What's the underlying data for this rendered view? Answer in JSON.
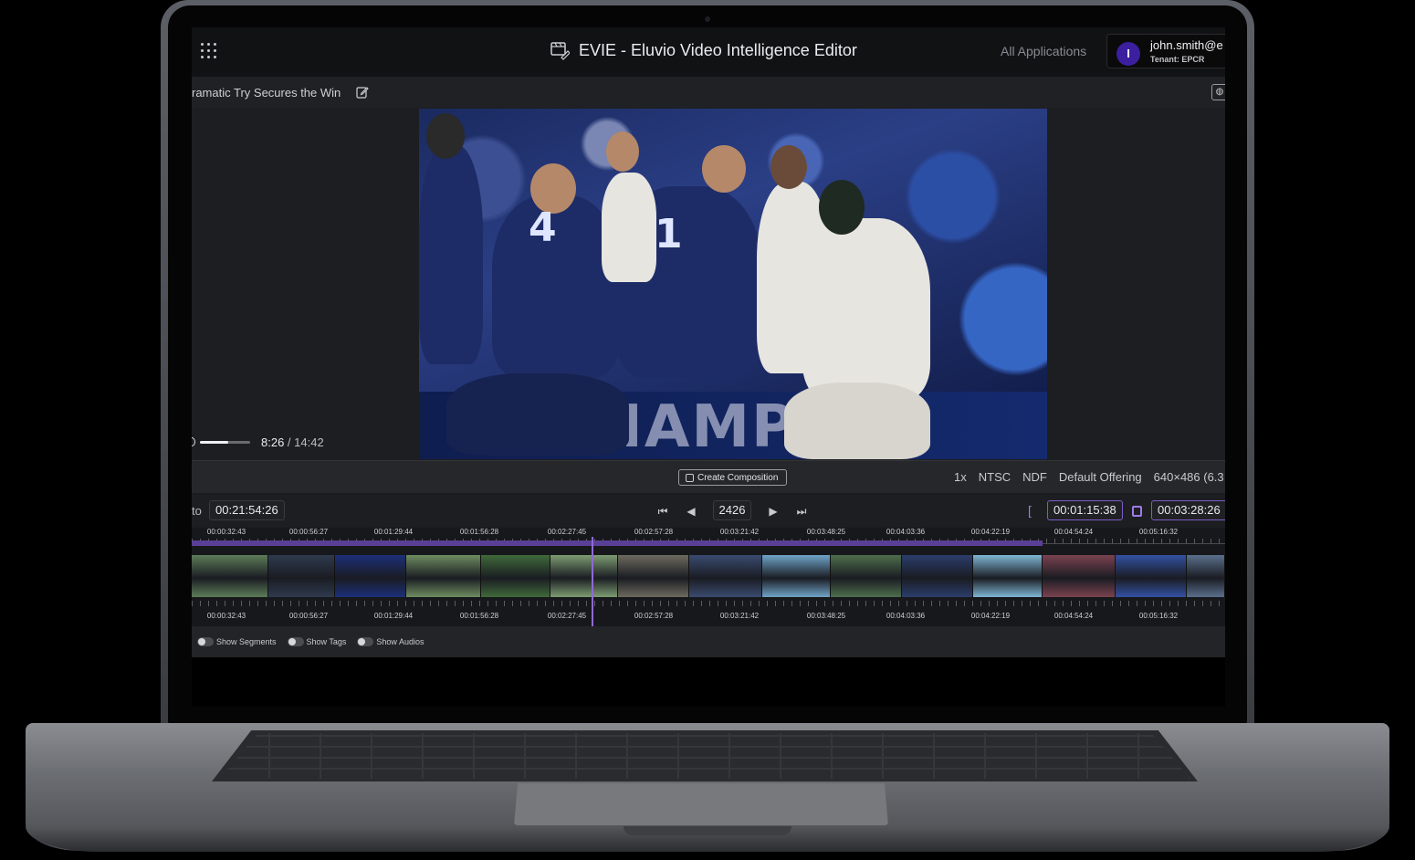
{
  "header": {
    "app_title": "EVIE - Eluvio Video Intelligence Editor",
    "all_apps_label": "All Applications",
    "user": {
      "avatar_initial": "I",
      "name": "john.smith@e",
      "tenant": "Tenant:  EPCR"
    }
  },
  "clip": {
    "title": "ramatic Try Secures the Win"
  },
  "video": {
    "banner_text": "te    CHAMPIC",
    "jersey_numbers": [
      "4",
      "1"
    ],
    "current_time": "8:26",
    "separator": " / ",
    "duration": "14:42",
    "progress_fraction": 0.57
  },
  "meta": {
    "create_label": "Create Composition",
    "items": [
      "1x",
      "NTSC",
      "NDF",
      "Default Offering",
      "640×486 (6.3"
    ]
  },
  "transport": {
    "to_label": "to",
    "to_timecode": "00:21:54:26",
    "frame": "2426",
    "in_timecode": "00:01:15:38",
    "out_timecode": "00:03:28:26",
    "in_bracket": "["
  },
  "timeline": {
    "labels": [
      "00:00:32:43",
      "00:00:56:27",
      "00:01:29:44",
      "00:01:56:28",
      "00:02:27:45",
      "00:02:57:28",
      "00:03:21:42",
      "00:03:48:25",
      "00:04:03:36",
      "00:04:22:19",
      "00:04:54:24",
      "00:05:16:32"
    ],
    "thumbnail_colors": [
      "#5d7c58",
      "#2e3a4e",
      "#1c2f7a",
      "#6f8c60",
      "#3f6a3a",
      "#7d9c72",
      "#6d6a5e",
      "#3a4b70",
      "#6fa4c8",
      "#4e6e4c",
      "#2b3d6c",
      "#7fb6d4",
      "#7a4250",
      "#3351a3",
      "#5a6f8c"
    ]
  },
  "toggles": [
    "Show Segments",
    "Show Tags",
    "Show Audios"
  ],
  "colors": {
    "accent": "#8e6ad6",
    "avatar": "#3b1f9e",
    "screen_bg": "#1b1c1f"
  }
}
